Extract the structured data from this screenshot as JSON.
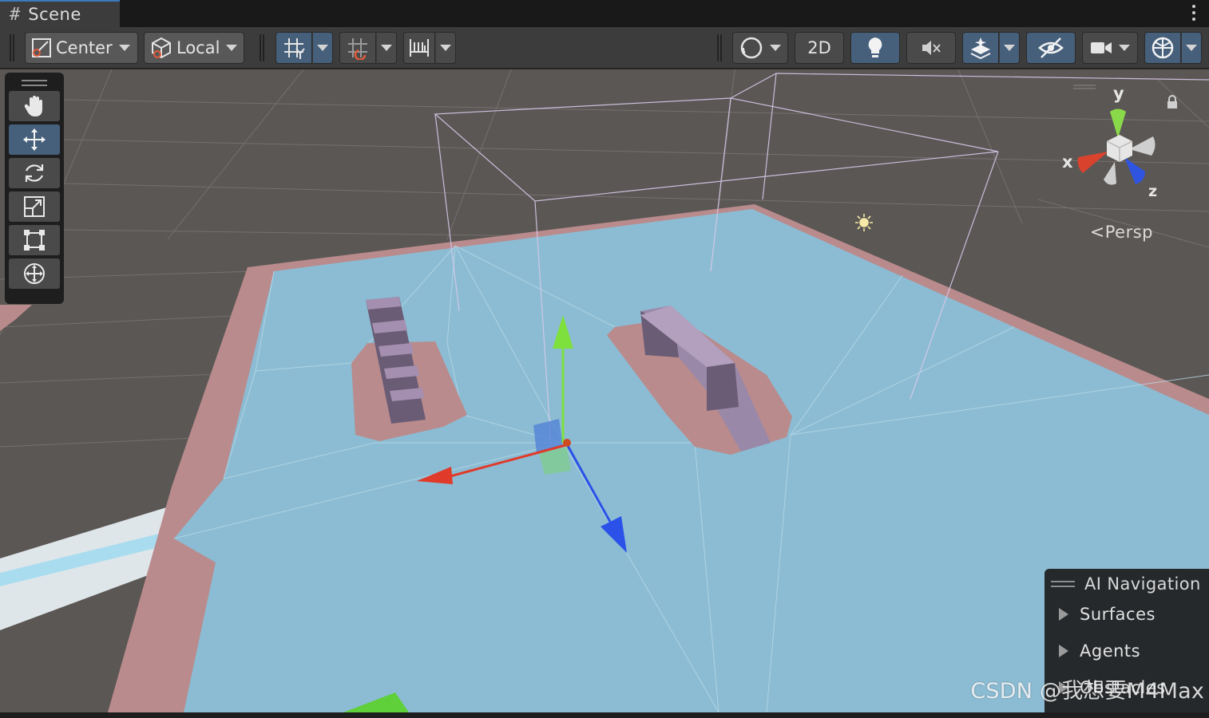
{
  "window": {
    "tab_title": "Scene"
  },
  "toolbar": {
    "pivot_mode": "Center",
    "pivot_rotation": "Local",
    "mode_2d": "2D",
    "icons": [
      "grid-snap-icon",
      "increment-snap-icon",
      "ruler-icon",
      "shading-mode-icon",
      "lighting-icon",
      "audio-mute-icon",
      "effects-icon",
      "visibility-icon",
      "camera-icon",
      "gizmos-icon"
    ]
  },
  "tools": [
    "hand-tool",
    "move-tool",
    "rotate-tool",
    "scale-tool",
    "rect-tool",
    "transform-tool"
  ],
  "gizmo": {
    "x_label": "x",
    "y_label": "y",
    "z_label": "z",
    "projection": "Persp"
  },
  "ai_navigation": {
    "title": "AI Navigation",
    "items": [
      "Surfaces",
      "Agents",
      "Obstacles"
    ]
  },
  "watermark": "CSDN @我想要M4Max",
  "colors": {
    "navmesh": "#8cbed6",
    "ground_edge": "#b88a8c",
    "grid_background": "#5c5855",
    "accent_active": "#46607c",
    "axis_x": "#e03a2a",
    "axis_y": "#7ee03c",
    "axis_z": "#2a52e8"
  }
}
